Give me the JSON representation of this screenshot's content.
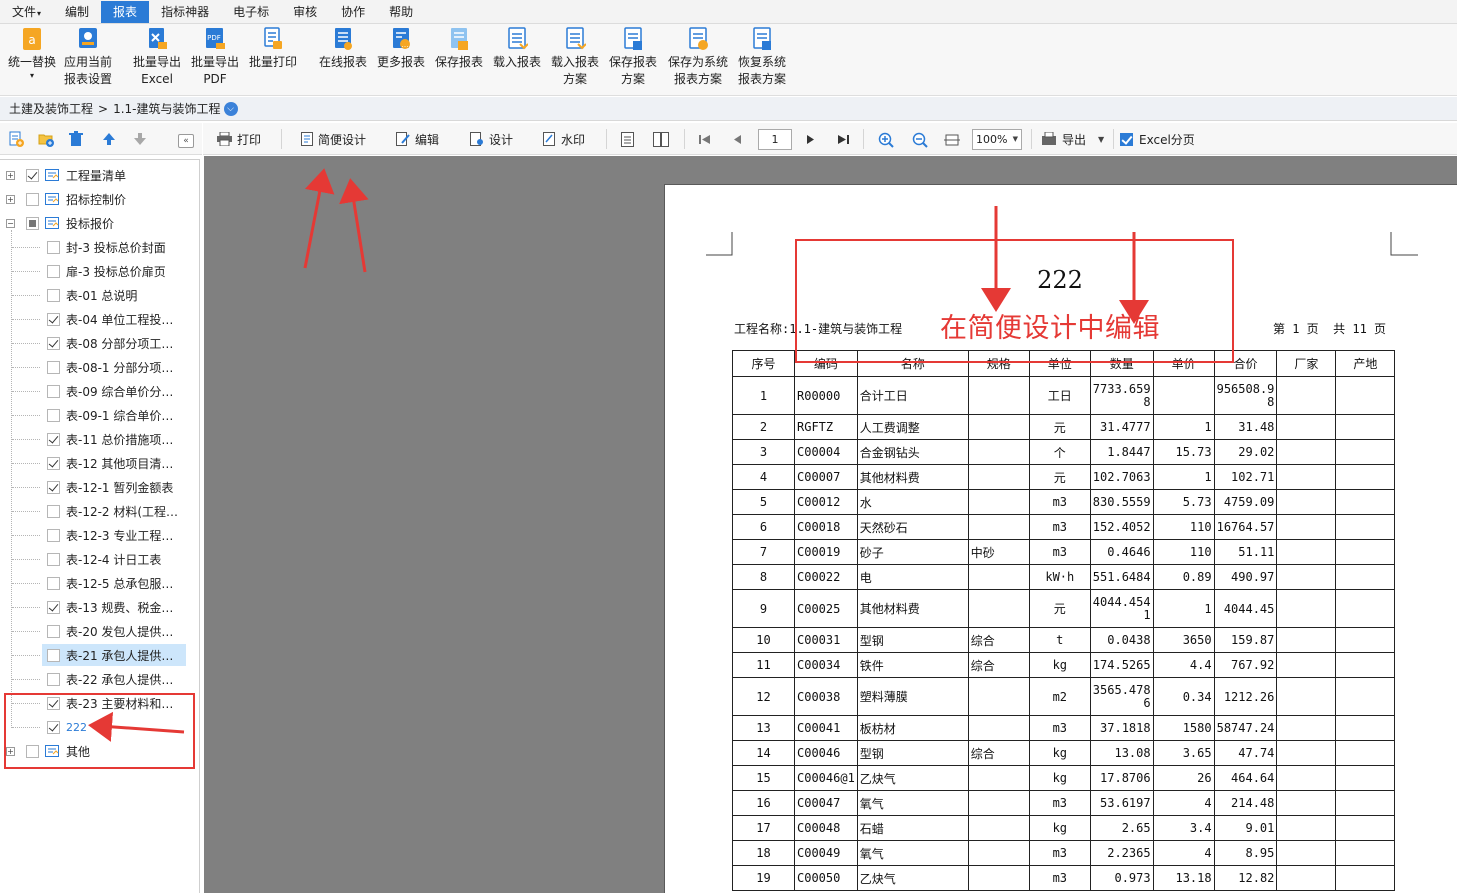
{
  "menu": [
    "文件",
    "编制",
    "报表",
    "指标神器",
    "电子标",
    "审核",
    "协作",
    "帮助"
  ],
  "menu_file_arrow": "▾",
  "ribbon": {
    "replace_all": [
      "统一替换",
      "▾"
    ],
    "apply_current": [
      "应用当前",
      "报表设置"
    ],
    "batch_excel": [
      "批量导出",
      "Excel"
    ],
    "batch_pdf": [
      "批量导出",
      "PDF"
    ],
    "batch_print": [
      "批量打印"
    ],
    "online_report": [
      "在线报表"
    ],
    "more_report": [
      "更多报表"
    ],
    "save_report": [
      "保存报表"
    ],
    "load_report": [
      "载入报表"
    ],
    "load_scheme": [
      "载入报表",
      "方案"
    ],
    "save_scheme": [
      "保存报表",
      "方案"
    ],
    "save_sys_scheme": [
      "保存为系统",
      "报表方案"
    ],
    "restore_sys_scheme": [
      "恢复系统",
      "报表方案"
    ]
  },
  "breadcrumb": {
    "root": "土建及装饰工程",
    "sep": ">",
    "current": "1.1-建筑与装饰工程"
  },
  "tree": {
    "top": [
      {
        "label": "工程量清单",
        "checked": true
      },
      {
        "label": "招标控制价",
        "checked": false
      },
      {
        "label": "投标报价",
        "checked": "partial"
      }
    ],
    "children": [
      {
        "label": "封-3 投标总价封面",
        "checked": false
      },
      {
        "label": "扉-3 投标总价扉页",
        "checked": false
      },
      {
        "label": "表-01 总说明",
        "checked": false
      },
      {
        "label": "表-04 单位工程投…",
        "checked": true
      },
      {
        "label": "表-08 分部分项工…",
        "checked": true
      },
      {
        "label": "表-08-1 分部分项…",
        "checked": false
      },
      {
        "label": "表-09 综合单价分…",
        "checked": false
      },
      {
        "label": "表-09-1 综合单价…",
        "checked": false
      },
      {
        "label": "表-11 总价措施项…",
        "checked": true
      },
      {
        "label": "表-12 其他项目清…",
        "checked": true
      },
      {
        "label": "表-12-1 暂列金额表",
        "checked": true
      },
      {
        "label": "表-12-2 材料(工程…",
        "checked": false
      },
      {
        "label": "表-12-3 专业工程…",
        "checked": false
      },
      {
        "label": "表-12-4 计日工表",
        "checked": false
      },
      {
        "label": "表-12-5 总承包服…",
        "checked": false
      },
      {
        "label": "表-13 规费、税金…",
        "checked": true
      },
      {
        "label": "表-20 发包人提供…",
        "checked": false
      },
      {
        "label": "表-21 承包人提供…",
        "checked": false
      },
      {
        "label": "表-22 承包人提供…",
        "checked": false
      },
      {
        "label": "表-23 主要材料和…",
        "checked": true
      },
      {
        "label": "222",
        "checked": true
      }
    ],
    "other": {
      "label": "其他",
      "checked": false
    }
  },
  "viewer_toolbar": {
    "print": "打印",
    "simple_design": "简便设计",
    "edit": "编辑",
    "design": "设计",
    "watermark": "水印",
    "page": "1",
    "zoom": "100%",
    "export": "导出",
    "excel_paging": "Excel分页"
  },
  "report": {
    "title": "222",
    "project_label": "工程名称:1.1-建筑与装饰工程",
    "page_info": "第 1 页  共 11 页",
    "headers": [
      "序号",
      "编码",
      "名称",
      "规格",
      "单位",
      "数量",
      "单价",
      "合价",
      "厂家",
      "产地"
    ],
    "rows": [
      {
        "no": "1",
        "code": "R00000",
        "name": "合计工日",
        "spec": "",
        "unit": "工日",
        "qty": "7733.6598",
        "price": "",
        "total": "956508.98",
        "tall": true
      },
      {
        "no": "2",
        "code": "RGFTZ",
        "name": "人工费调整",
        "spec": "",
        "unit": "元",
        "qty": "31.4777",
        "price": "1",
        "total": "31.48"
      },
      {
        "no": "3",
        "code": "C00004",
        "name": "合金钢钻头",
        "spec": "",
        "unit": "个",
        "qty": "1.8447",
        "price": "15.73",
        "total": "29.02"
      },
      {
        "no": "4",
        "code": "C00007",
        "name": "其他材料费",
        "spec": "",
        "unit": "元",
        "qty": "102.7063",
        "price": "1",
        "total": "102.71"
      },
      {
        "no": "5",
        "code": "C00012",
        "name": "水",
        "spec": "",
        "unit": "m3",
        "qty": "830.5559",
        "price": "5.73",
        "total": "4759.09"
      },
      {
        "no": "6",
        "code": "C00018",
        "name": "天然砂石",
        "spec": "",
        "unit": "m3",
        "qty": "152.4052",
        "price": "110",
        "total": "16764.57"
      },
      {
        "no": "7",
        "code": "C00019",
        "name": "砂子",
        "spec": "中砂",
        "unit": "m3",
        "qty": "0.4646",
        "price": "110",
        "total": "51.11"
      },
      {
        "no": "8",
        "code": "C00022",
        "name": "电",
        "spec": "",
        "unit": "kW·h",
        "qty": "551.6484",
        "price": "0.89",
        "total": "490.97"
      },
      {
        "no": "9",
        "code": "C00025",
        "name": "其他材料费",
        "spec": "",
        "unit": "元",
        "qty": "4044.4541",
        "price": "1",
        "total": "4044.45",
        "tall": true
      },
      {
        "no": "10",
        "code": "C00031",
        "name": "型钢",
        "spec": "综合",
        "unit": "t",
        "qty": "0.0438",
        "price": "3650",
        "total": "159.87"
      },
      {
        "no": "11",
        "code": "C00034",
        "name": "铁件",
        "spec": "综合",
        "unit": "kg",
        "qty": "174.5265",
        "price": "4.4",
        "total": "767.92"
      },
      {
        "no": "12",
        "code": "C00038",
        "name": "塑料薄膜",
        "spec": "",
        "unit": "m2",
        "qty": "3565.4786",
        "price": "0.34",
        "total": "1212.26",
        "tall": true
      },
      {
        "no": "13",
        "code": "C00041",
        "name": "板枋材",
        "spec": "",
        "unit": "m3",
        "qty": "37.1818",
        "price": "1580",
        "total": "58747.24"
      },
      {
        "no": "14",
        "code": "C00046",
        "name": "型钢",
        "spec": "综合",
        "unit": "kg",
        "qty": "13.08",
        "price": "3.65",
        "total": "47.74"
      },
      {
        "no": "15",
        "code": "C00046@1",
        "name": "乙炔气",
        "spec": "",
        "unit": "kg",
        "qty": "17.8706",
        "price": "26",
        "total": "464.64"
      },
      {
        "no": "16",
        "code": "C00047",
        "name": "氧气",
        "spec": "",
        "unit": "m3",
        "qty": "53.6197",
        "price": "4",
        "total": "214.48"
      },
      {
        "no": "17",
        "code": "C00048",
        "name": "石蜡",
        "spec": "",
        "unit": "kg",
        "qty": "2.65",
        "price": "3.4",
        "total": "9.01"
      },
      {
        "no": "18",
        "code": "C00049",
        "name": "氧气",
        "spec": "",
        "unit": "m3",
        "qty": "2.2365",
        "price": "4",
        "total": "8.95"
      },
      {
        "no": "19",
        "code": "C00050",
        "name": "乙炔气",
        "spec": "",
        "unit": "m3",
        "qty": "0.973",
        "price": "13.18",
        "total": "12.82"
      }
    ]
  },
  "annotation": {
    "text": "在简便设计中编辑",
    "color": "#e53935"
  },
  "colors": {
    "accent": "#2b7bd6",
    "canvas": "#808080",
    "selected": "#cde6fb"
  }
}
